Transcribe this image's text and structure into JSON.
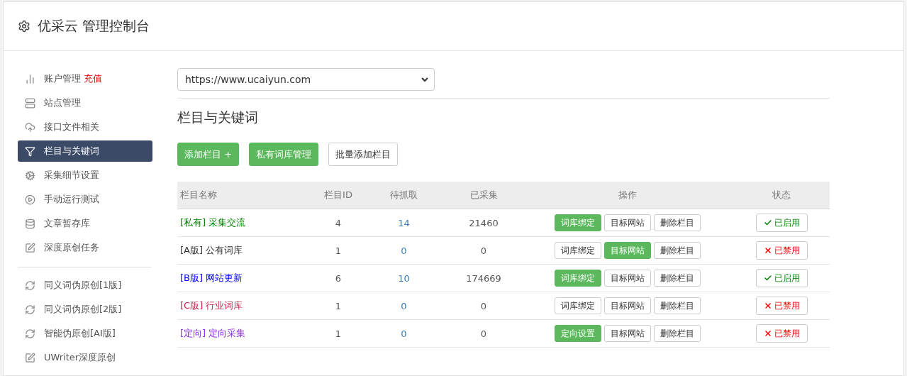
{
  "header": {
    "title": "优采云 管理控制台"
  },
  "sidebar": {
    "groups": [
      [
        {
          "label": "账户管理",
          "badge": "充值",
          "selected": false
        },
        {
          "label": "站点管理",
          "selected": false
        },
        {
          "label": "接口文件相关",
          "selected": false
        },
        {
          "label": "栏目与关键词",
          "selected": true
        },
        {
          "label": "采集细节设置",
          "selected": false
        },
        {
          "label": "手动运行测试",
          "selected": false
        },
        {
          "label": "文章暂存库",
          "selected": false
        },
        {
          "label": "深度原创任务",
          "selected": false
        }
      ],
      [
        {
          "label": "同义词伪原创[1版]",
          "selected": false
        },
        {
          "label": "同义词伪原创[2版]",
          "selected": false
        },
        {
          "label": "智能伪原创[AI版]",
          "selected": false
        },
        {
          "label": "UWriter深度原创",
          "selected": false
        }
      ]
    ]
  },
  "site_select": {
    "value": "https://www.ucaiyun.com"
  },
  "section_title": "栏目与关键词",
  "toolbar": [
    {
      "label": "添加栏目 +",
      "primary": true
    },
    {
      "label": "私有词库管理",
      "primary": true
    },
    {
      "label": "批量添加栏目",
      "primary": false
    }
  ],
  "table": {
    "columns": [
      "栏目名称",
      "栏目ID",
      "待抓取",
      "已采集",
      "操作",
      "状态"
    ],
    "rows": [
      {
        "tag": "[私有]",
        "name": "采集交流",
        "color": "#008000",
        "id": "4",
        "pending": "14",
        "collected": "21460",
        "actions": [
          {
            "label": "词库绑定",
            "active": true
          },
          {
            "label": "目标网站",
            "active": false
          },
          {
            "label": "删除栏目",
            "active": false
          }
        ],
        "status": {
          "label": "已启用",
          "enabled": true
        }
      },
      {
        "tag": "[A版]",
        "name": "公有词库",
        "color": "#333333",
        "id": "1",
        "pending": "0",
        "collected": "0",
        "actions": [
          {
            "label": "词库绑定",
            "active": false
          },
          {
            "label": "目标网站",
            "active": true
          },
          {
            "label": "删除栏目",
            "active": false
          }
        ],
        "status": {
          "label": "已禁用",
          "enabled": false
        }
      },
      {
        "tag": "[B版]",
        "name": "网站更新",
        "color": "#0000ff",
        "id": "6",
        "pending": "10",
        "collected": "174669",
        "actions": [
          {
            "label": "词库绑定",
            "active": true
          },
          {
            "label": "目标网站",
            "active": false
          },
          {
            "label": "删除栏目",
            "active": false
          }
        ],
        "status": {
          "label": "已启用",
          "enabled": true
        }
      },
      {
        "tag": "[C版]",
        "name": "行业词库",
        "color": "#c7254e",
        "id": "1",
        "pending": "0",
        "collected": "0",
        "actions": [
          {
            "label": "词库绑定",
            "active": false
          },
          {
            "label": "目标网站",
            "active": false
          },
          {
            "label": "删除栏目",
            "active": false
          }
        ],
        "status": {
          "label": "已禁用",
          "enabled": false
        }
      },
      {
        "tag": "[定向]",
        "name": "定向采集",
        "color": "#8a2be2",
        "id": "1",
        "pending": "0",
        "collected": "0",
        "actions": [
          {
            "label": "定向设置",
            "active": true
          },
          {
            "label": "目标网站",
            "active": false
          },
          {
            "label": "删除栏目",
            "active": false
          }
        ],
        "status": {
          "label": "已禁用",
          "enabled": false
        }
      }
    ]
  }
}
